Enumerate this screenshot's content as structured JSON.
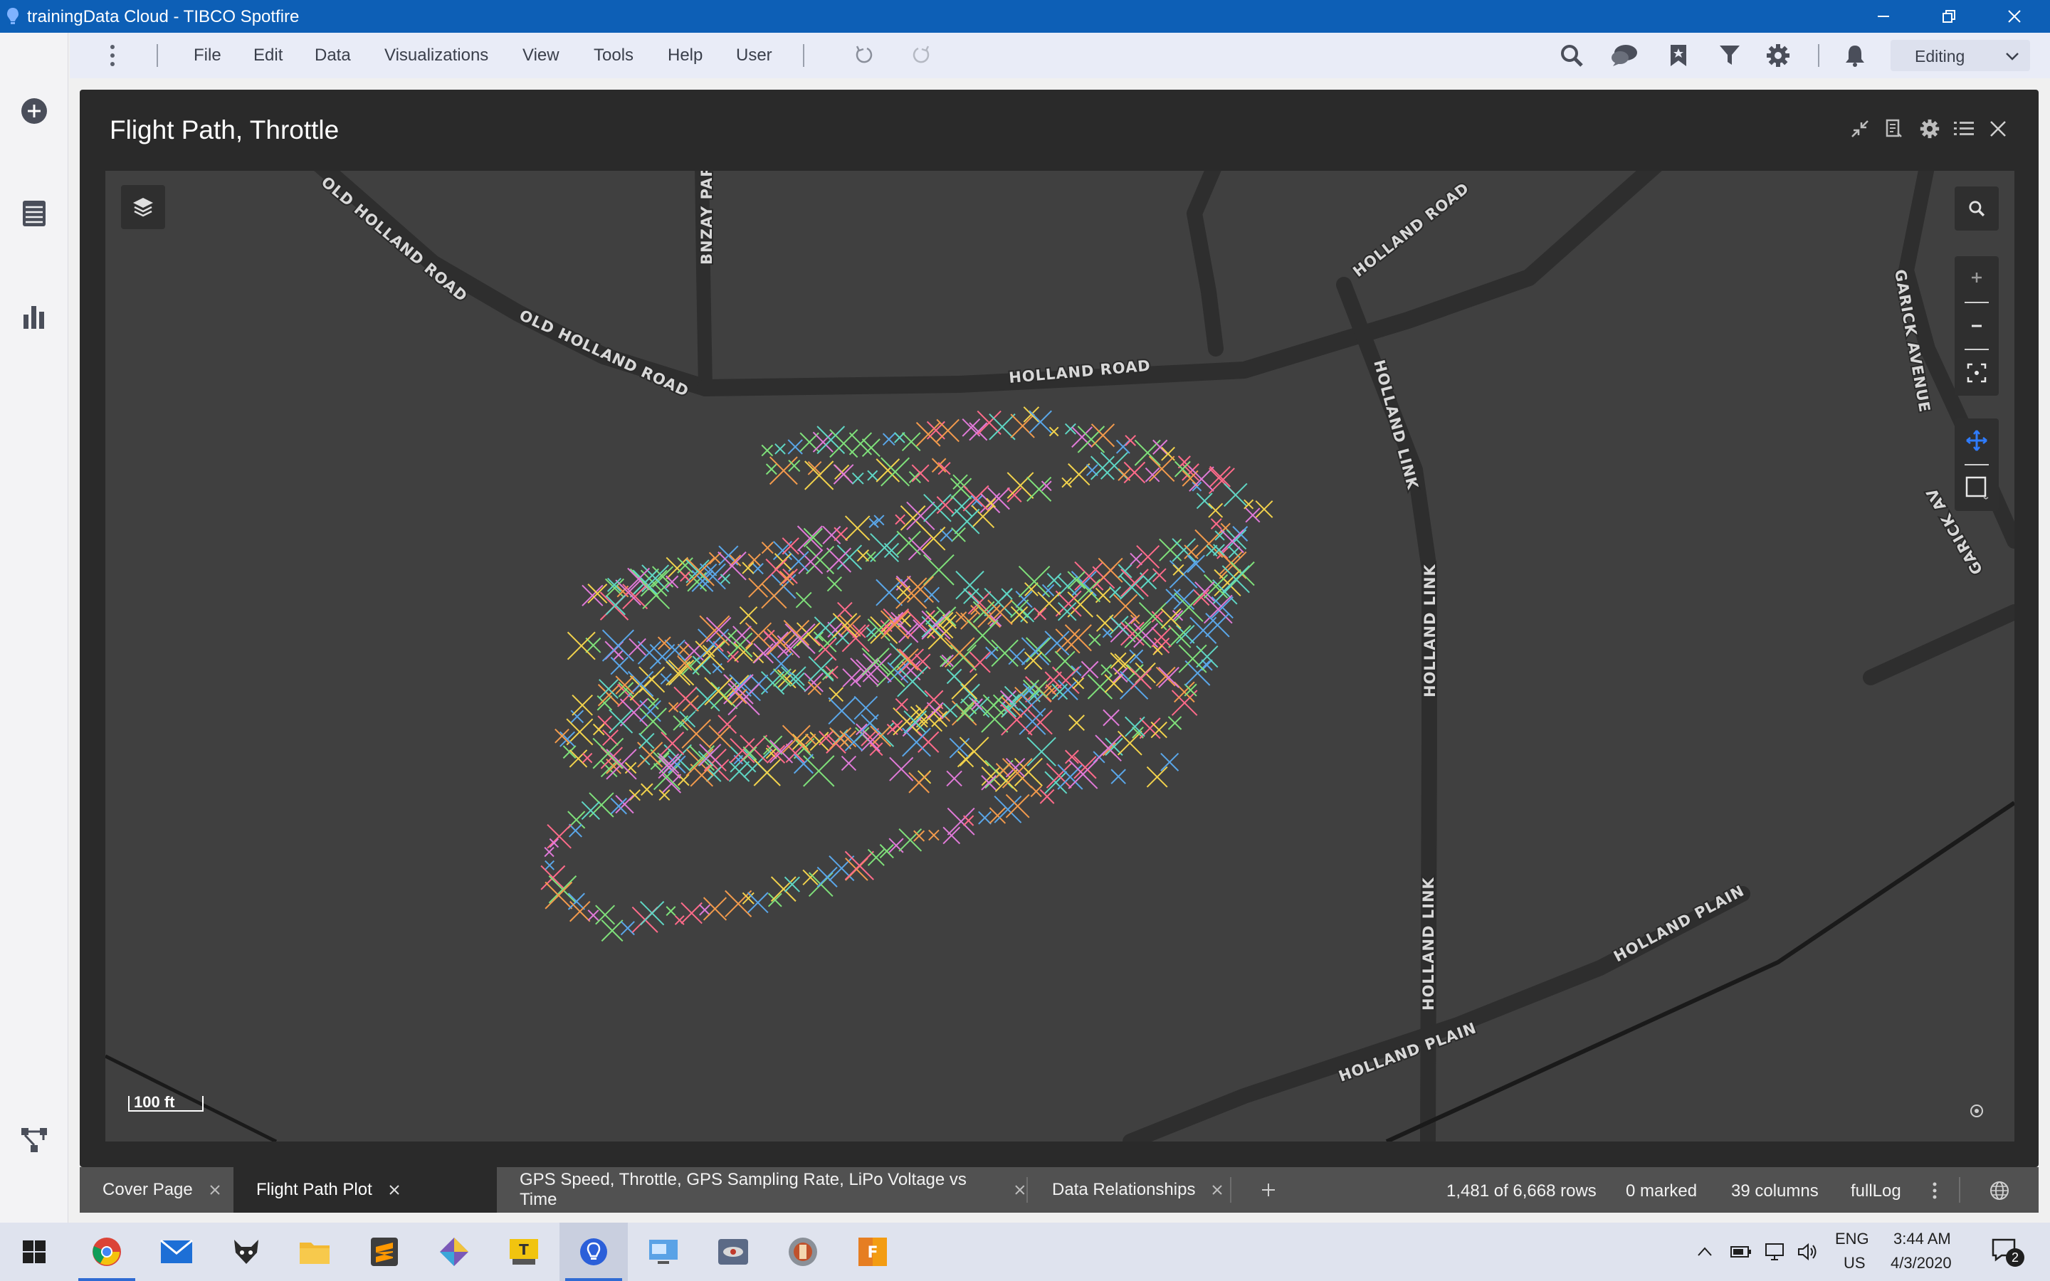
{
  "window": {
    "title": "trainingData Cloud - TIBCO Spotfire"
  },
  "menu": {
    "items": [
      "File",
      "Edit",
      "Data",
      "Visualizations",
      "View",
      "Tools",
      "Help",
      "User"
    ],
    "mode": "Editing"
  },
  "visualization": {
    "title": "Flight Path, Throttle",
    "scale_label": "100 ft",
    "road_labels": {
      "old_holland_road_1": "OLD HOLLAND ROAD",
      "old_holland_road_2": "OLD HOLLAND ROAD",
      "bnzay_park": "BNZAY PARK",
      "holland_road_1": "HOLLAND ROAD",
      "holland_road_2": "HOLLAND ROAD",
      "holland_link_1": "HOLLAND LINK",
      "holland_link_2": "HOLLAND LINK",
      "holland_link_3": "HOLLAND LINK",
      "garick_avenue": "GARICK AVENUE",
      "garick_av": "GARICK AV",
      "holland_plain_1": "HOLLAND PLAIN",
      "holland_plain_2": "HOLLAND PLAIN"
    },
    "marker_colors": [
      "#ff6b8a",
      "#7fe07a",
      "#f2d24c",
      "#e07ad8",
      "#f29a4c",
      "#5aa6e8",
      "#5fd6c4"
    ]
  },
  "tabs": [
    {
      "label": "Cover Page",
      "active": false
    },
    {
      "label": "Flight Path Plot",
      "active": true
    },
    {
      "label": "GPS Speed, Throttle, GPS Sampling Rate, LiPo Voltage vs Time",
      "active": false
    },
    {
      "label": "Data Relationships",
      "active": false
    }
  ],
  "status": {
    "rows": "1,481 of 6,668 rows",
    "marked": "0 marked",
    "columns": "39 columns",
    "table": "fullLog"
  },
  "taskbar": {
    "lang": "ENG",
    "region": "US",
    "time": "3:44 AM",
    "date": "4/3/2020",
    "notification_count": "2"
  }
}
